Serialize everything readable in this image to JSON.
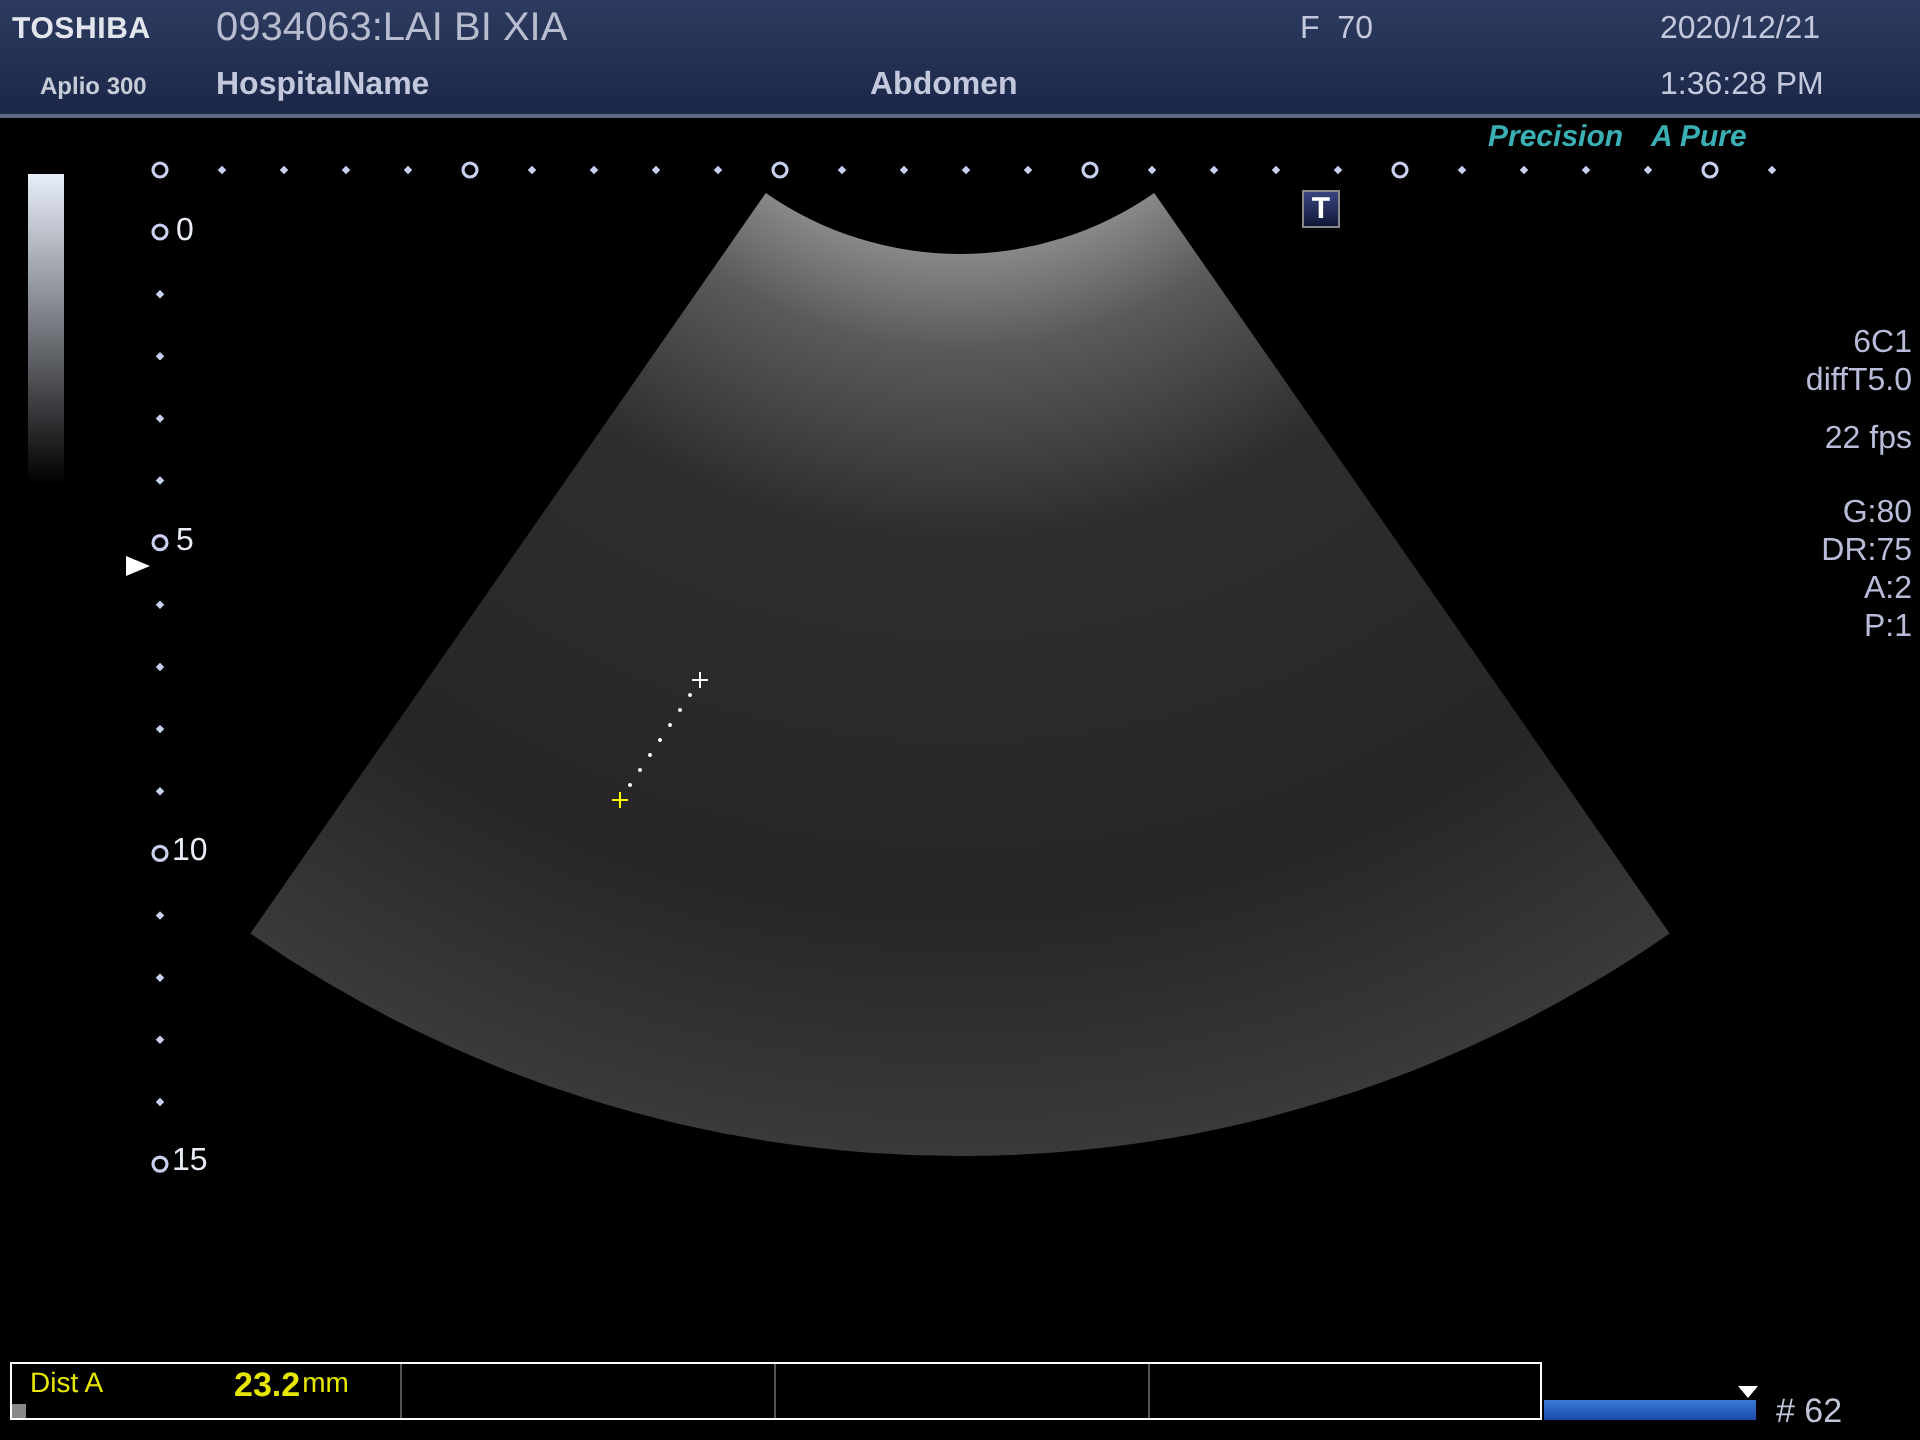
{
  "header": {
    "brand": "TOSHIBA",
    "model": "Aplio 300",
    "patient": "0934063:LAI BI XIA",
    "hospital": "HospitalName",
    "sex_age": "F  70",
    "exam": "Abdomen",
    "date": "2020/12/21",
    "time": "1:36:28 PM"
  },
  "modes": [
    "Precision",
    "A Pure"
  ],
  "marker_icon": "T",
  "depth_labels": [
    "0",
    "5",
    "10",
    "15"
  ],
  "info_groups": [
    [
      "6C1",
      "diffT5.0"
    ],
    [
      "22 fps"
    ],
    [
      "G:80",
      "DR:75",
      "A:2",
      "P:1"
    ]
  ],
  "measurement": {
    "label": "Dist A",
    "value": "23.2",
    "unit": "mm"
  },
  "cine": {
    "level": 1,
    "frame": "# 62"
  }
}
